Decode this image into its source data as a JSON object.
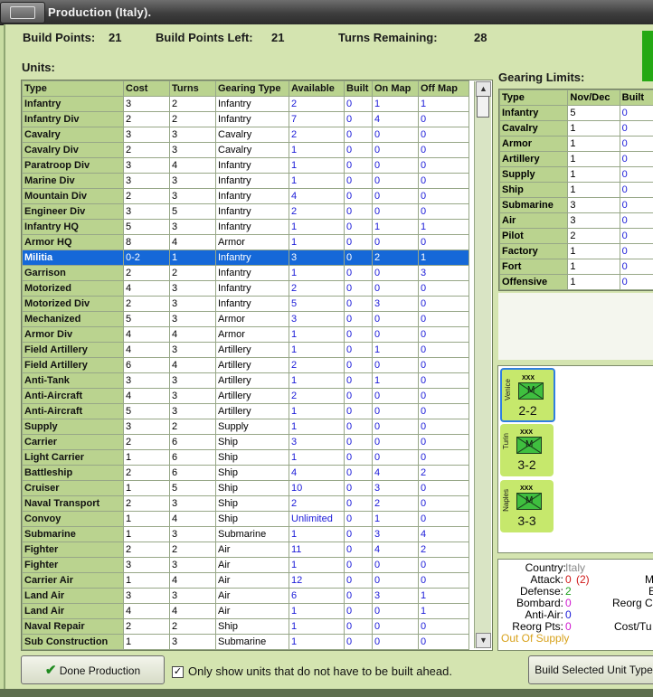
{
  "window": {
    "title": "Production (Italy)."
  },
  "stats": {
    "bp_label": "Build Points:",
    "bp_value": "21",
    "bpl_label": "Build Points Left:",
    "bpl_value": "21",
    "turns_label": "Turns Remaining:",
    "turns_value": "28"
  },
  "units_label": "Units:",
  "units_columns": [
    "Type",
    "Cost",
    "Turns",
    "Gearing Type",
    "Available",
    "Built",
    "On Map",
    "Off Map"
  ],
  "units": [
    [
      "Infantry",
      "3",
      "2",
      "Infantry",
      "2",
      "0",
      "1",
      "1"
    ],
    [
      "Infantry Div",
      "2",
      "2",
      "Infantry",
      "7",
      "0",
      "4",
      "0"
    ],
    [
      "Cavalry",
      "3",
      "3",
      "Cavalry",
      "2",
      "0",
      "0",
      "0"
    ],
    [
      "Cavalry Div",
      "2",
      "3",
      "Cavalry",
      "1",
      "0",
      "0",
      "0"
    ],
    [
      "Paratroop Div",
      "3",
      "4",
      "Infantry",
      "1",
      "0",
      "0",
      "0"
    ],
    [
      "Marine Div",
      "3",
      "3",
      "Infantry",
      "1",
      "0",
      "0",
      "0"
    ],
    [
      "Mountain Div",
      "2",
      "3",
      "Infantry",
      "4",
      "0",
      "0",
      "0"
    ],
    [
      "Engineer Div",
      "3",
      "5",
      "Infantry",
      "2",
      "0",
      "0",
      "0"
    ],
    [
      "Infantry HQ",
      "5",
      "3",
      "Infantry",
      "1",
      "0",
      "1",
      "1"
    ],
    [
      "Armor HQ",
      "8",
      "4",
      "Armor",
      "1",
      "0",
      "0",
      "0"
    ],
    [
      "Militia",
      "0-2",
      "1",
      "Infantry",
      "3",
      "0",
      "2",
      "1"
    ],
    [
      "Garrison",
      "2",
      "2",
      "Infantry",
      "1",
      "0",
      "0",
      "3"
    ],
    [
      "Motorized",
      "4",
      "3",
      "Infantry",
      "2",
      "0",
      "0",
      "0"
    ],
    [
      "Motorized Div",
      "2",
      "3",
      "Infantry",
      "5",
      "0",
      "3",
      "0"
    ],
    [
      "Mechanized",
      "5",
      "3",
      "Armor",
      "3",
      "0",
      "0",
      "0"
    ],
    [
      "Armor Div",
      "4",
      "4",
      "Armor",
      "1",
      "0",
      "0",
      "0"
    ],
    [
      "Field Artillery",
      "4",
      "3",
      "Artillery",
      "1",
      "0",
      "1",
      "0"
    ],
    [
      "Field Artillery",
      "6",
      "4",
      "Artillery",
      "2",
      "0",
      "0",
      "0"
    ],
    [
      "Anti-Tank",
      "3",
      "3",
      "Artillery",
      "1",
      "0",
      "1",
      "0"
    ],
    [
      "Anti-Aircraft",
      "4",
      "3",
      "Artillery",
      "2",
      "0",
      "0",
      "0"
    ],
    [
      "Anti-Aircraft",
      "5",
      "3",
      "Artillery",
      "1",
      "0",
      "0",
      "0"
    ],
    [
      "Supply",
      "3",
      "2",
      "Supply",
      "1",
      "0",
      "0",
      "0"
    ],
    [
      "Carrier",
      "2",
      "6",
      "Ship",
      "3",
      "0",
      "0",
      "0"
    ],
    [
      "Light Carrier",
      "1",
      "6",
      "Ship",
      "1",
      "0",
      "0",
      "0"
    ],
    [
      "Battleship",
      "2",
      "6",
      "Ship",
      "4",
      "0",
      "4",
      "2"
    ],
    [
      "Cruiser",
      "1",
      "5",
      "Ship",
      "10",
      "0",
      "3",
      "0"
    ],
    [
      "Naval Transport",
      "2",
      "3",
      "Ship",
      "2",
      "0",
      "2",
      "0"
    ],
    [
      "Convoy",
      "1",
      "4",
      "Ship",
      "Unlimited",
      "0",
      "1",
      "0"
    ],
    [
      "Submarine",
      "1",
      "3",
      "Submarine",
      "1",
      "0",
      "3",
      "4"
    ],
    [
      "Fighter",
      "2",
      "2",
      "Air",
      "11",
      "0",
      "4",
      "2"
    ],
    [
      "Fighter",
      "3",
      "3",
      "Air",
      "1",
      "0",
      "0",
      "0"
    ],
    [
      "Carrier Air",
      "1",
      "4",
      "Air",
      "12",
      "0",
      "0",
      "0"
    ],
    [
      "Land Air",
      "3",
      "3",
      "Air",
      "6",
      "0",
      "3",
      "1"
    ],
    [
      "Land Air",
      "4",
      "4",
      "Air",
      "1",
      "0",
      "0",
      "1"
    ],
    [
      "Naval Repair",
      "2",
      "2",
      "Ship",
      "1",
      "0",
      "0",
      "0"
    ],
    [
      "Sub Construction",
      "1",
      "3",
      "Submarine",
      "1",
      "0",
      "0",
      "0"
    ]
  ],
  "selected_unit": "Militia",
  "gearing": {
    "label": "Gearing Limits:",
    "columns": [
      "Type",
      "Nov/Dec",
      "Built"
    ],
    "rows": [
      [
        "Infantry",
        "5",
        "0"
      ],
      [
        "Cavalry",
        "1",
        "0"
      ],
      [
        "Armor",
        "1",
        "0"
      ],
      [
        "Artillery",
        "1",
        "0"
      ],
      [
        "Supply",
        "1",
        "0"
      ],
      [
        "Ship",
        "1",
        "0"
      ],
      [
        "Submarine",
        "3",
        "0"
      ],
      [
        "Air",
        "3",
        "0"
      ],
      [
        "Pilot",
        "2",
        "0"
      ],
      [
        "Factory",
        "1",
        "0"
      ],
      [
        "Fort",
        "1",
        "0"
      ],
      [
        "Offensive",
        "1",
        "0"
      ]
    ]
  },
  "counters": [
    {
      "city": "Venice",
      "size": "XXX",
      "type": "M",
      "strength": "2-2"
    },
    {
      "city": "Turin",
      "size": "XXX",
      "type": "M",
      "strength": "3-2"
    },
    {
      "city": "Naples",
      "size": "XXX",
      "type": "M",
      "strength": "3-3"
    }
  ],
  "info": {
    "country_label": "Country:",
    "country": "Italy",
    "attack_label": "Attack:",
    "attack": "0",
    "attack_extra": "(2)",
    "defense_label": "Defense:",
    "defense": "2",
    "bombard_label": "Bombard:",
    "bombard": "0",
    "antiair_label": "Anti-Air:",
    "antiair": "0",
    "reorg_label": "Reorg Pts:",
    "reorg": "0",
    "supply_status": "Out Of Supply",
    "cut_m": "M",
    "cut_e": "E",
    "cut_reorg": "Reorg C",
    "cut_cost": "Cost/Tu"
  },
  "buttons": {
    "done": "Done Production",
    "build": "Build Selected Unit Type"
  },
  "checkbox": {
    "label": "Only show units that do not have to be built ahead.",
    "checked": "✓"
  },
  "colors": {
    "background": "#d4e4b0",
    "header": "#bad38f",
    "selected_row": "#1568d8",
    "number_blue": "#1b1bd8",
    "counter": "#c6e86c",
    "accent_green": "#25a814"
  }
}
